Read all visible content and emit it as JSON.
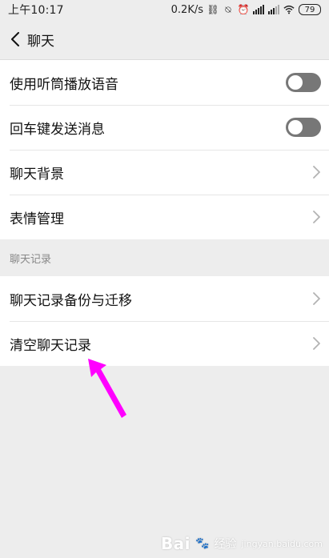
{
  "status_bar": {
    "time": "上午10:17",
    "network_speed": "0.2K/s",
    "battery": "79",
    "icons": [
      "link-icon",
      "no-disturb-icon",
      "alarm-icon",
      "hd-signal-icon",
      "signal-icon",
      "wifi-icon",
      "battery-icon"
    ]
  },
  "header": {
    "title": "聊天"
  },
  "settings": {
    "items": [
      {
        "label": "使用听筒播放语音",
        "control": "toggle",
        "on": false
      },
      {
        "label": "回车键发送消息",
        "control": "toggle",
        "on": false
      },
      {
        "label": "聊天背景",
        "control": "chevron"
      },
      {
        "label": "表情管理",
        "control": "chevron"
      }
    ]
  },
  "chat_history": {
    "section_title": "聊天记录",
    "items": [
      {
        "label": "聊天记录备份与迁移",
        "control": "chevron"
      },
      {
        "label": "清空聊天记录",
        "control": "chevron"
      }
    ]
  },
  "annotation": {
    "arrow_color": "#ff00ff"
  },
  "watermark": {
    "logo": "Bai",
    "text": "经验",
    "sub": "jingyan.baidu.com"
  },
  "colors": {
    "background": "#ededed",
    "card": "#ffffff",
    "toggle_off": "#777777"
  }
}
